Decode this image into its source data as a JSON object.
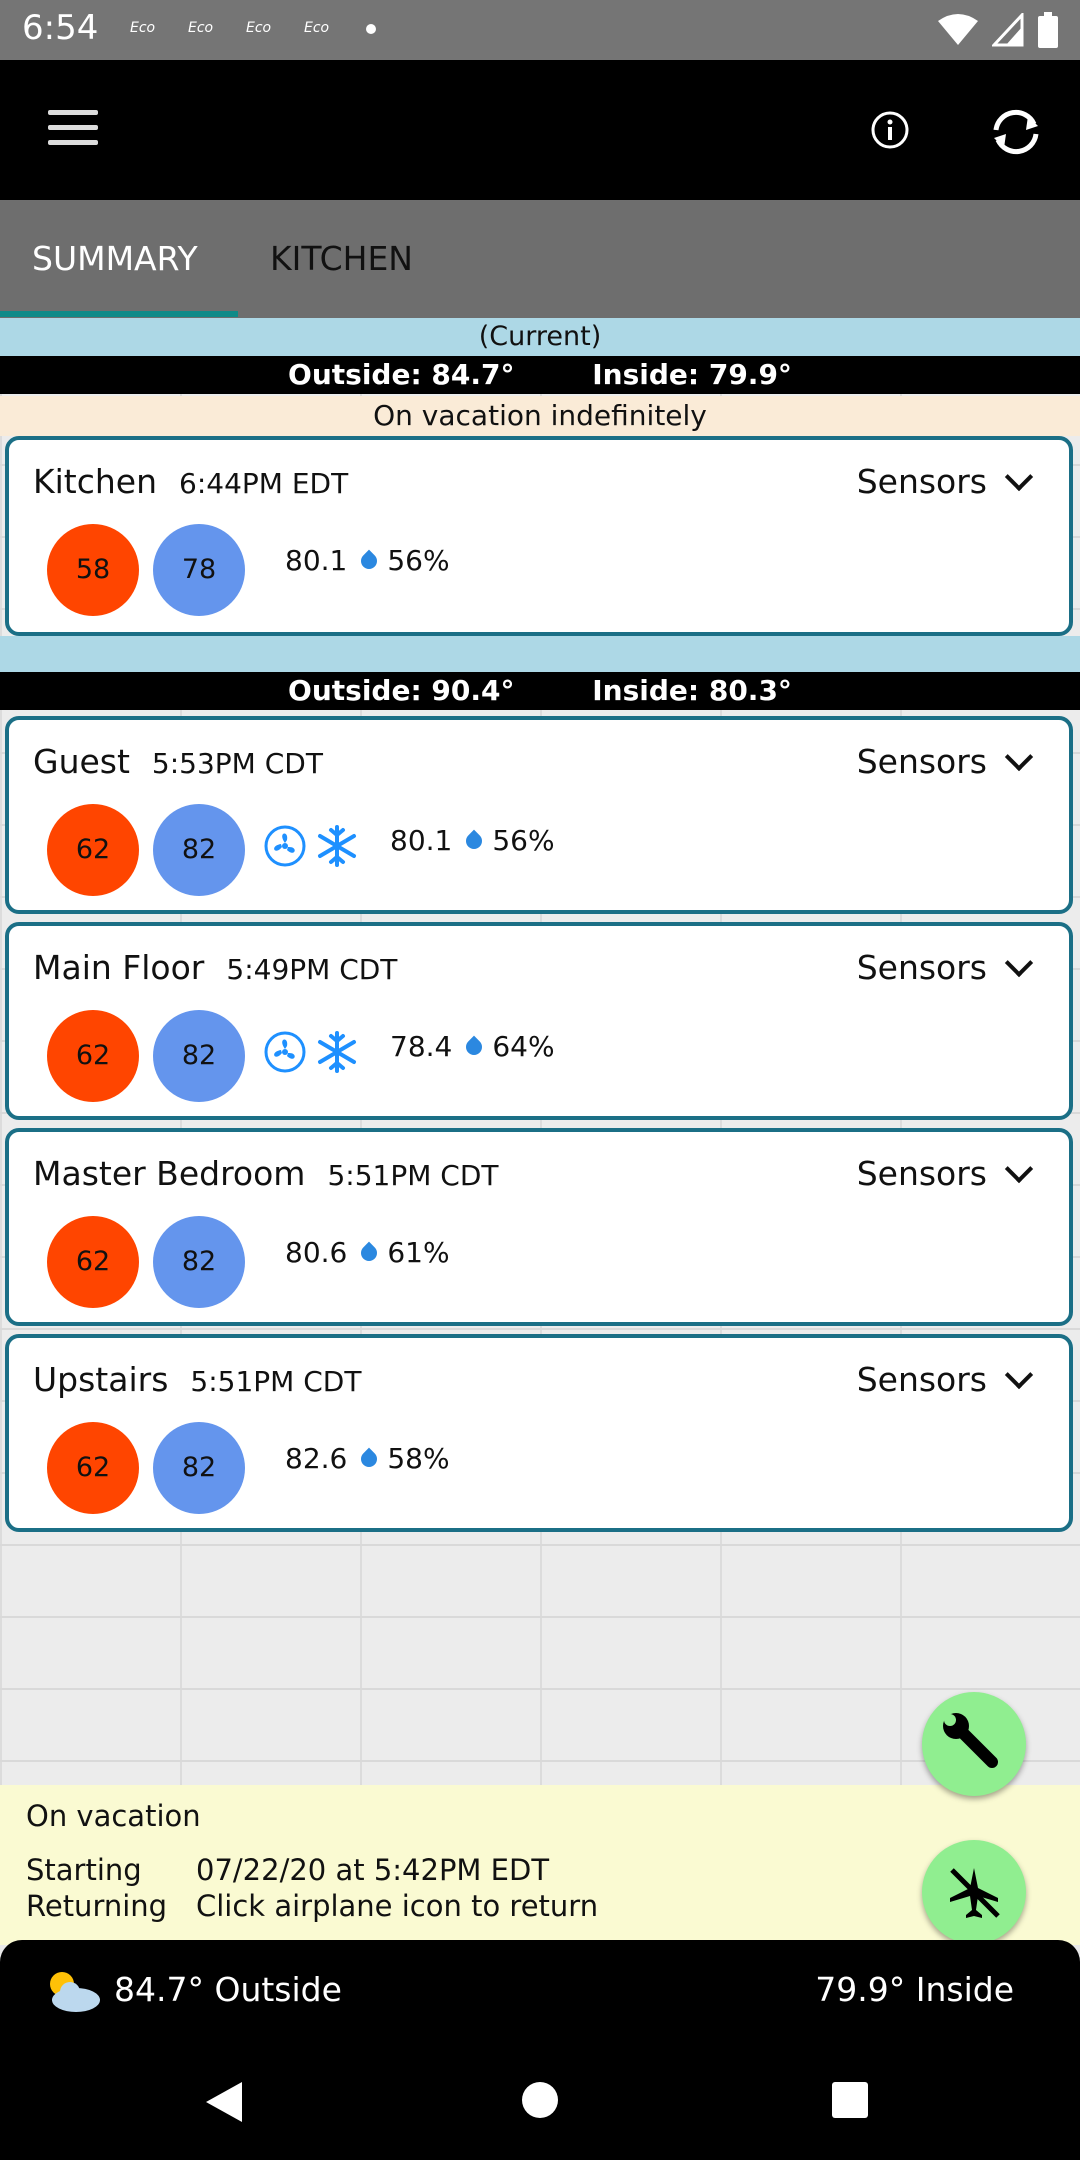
{
  "status_bar": {
    "time": "6:54",
    "notifications": [
      "Eco",
      "Eco",
      "Eco",
      "Eco"
    ]
  },
  "toolbar": {
    "menu_icon": "hamburger-icon",
    "info_icon": "info-icon",
    "refresh_icon": "refresh-icon"
  },
  "tabs": [
    {
      "label": "SUMMARY",
      "active": true
    },
    {
      "label": "KITCHEN",
      "active": false
    }
  ],
  "group1": {
    "current_label": "(Current)",
    "outside": "Outside: 84.7°",
    "inside": "Inside: 79.9°",
    "vacation": "On vacation indefinitely"
  },
  "group2": {
    "outside": "Outside: 90.4°",
    "inside": "Inside: 80.3°"
  },
  "thermostats": [
    {
      "name": "Kitchen",
      "time": "6:44PM EDT",
      "sensors": "Sensors",
      "heat": "58",
      "cool": "78",
      "temp": "80.1",
      "humidity": "56%",
      "modes": false
    },
    {
      "name": "Guest",
      "time": "5:53PM CDT",
      "sensors": "Sensors",
      "heat": "62",
      "cool": "82",
      "temp": "80.1",
      "humidity": "56%",
      "modes": true
    },
    {
      "name": "Main Floor",
      "time": "5:49PM CDT",
      "sensors": "Sensors",
      "heat": "62",
      "cool": "82",
      "temp": "78.4",
      "humidity": "64%",
      "modes": true
    },
    {
      "name": "Master Bedroom",
      "time": "5:51PM CDT",
      "sensors": "Sensors",
      "heat": "62",
      "cool": "82",
      "temp": "80.6",
      "humidity": "61%",
      "modes": false
    },
    {
      "name": "Upstairs",
      "time": "5:51PM CDT",
      "sensors": "Sensors",
      "heat": "62",
      "cool": "82",
      "temp": "82.6",
      "humidity": "58%",
      "modes": false
    }
  ],
  "vacation_panel": {
    "title": "On vacation",
    "starting_label": "Starting",
    "starting_value": "07/22/20 at 5:42PM EDT",
    "returning_label": "Returning",
    "returning_value": "Click airplane icon to return"
  },
  "bottom": {
    "outside": "84.7° Outside",
    "inside": "79.9° Inside",
    "weather_icon": "partly-cloudy-icon"
  },
  "colors": {
    "heat": "#ff4500",
    "cool": "#6495ed",
    "card_border": "#1b6f86",
    "fab": "#90ee90"
  }
}
